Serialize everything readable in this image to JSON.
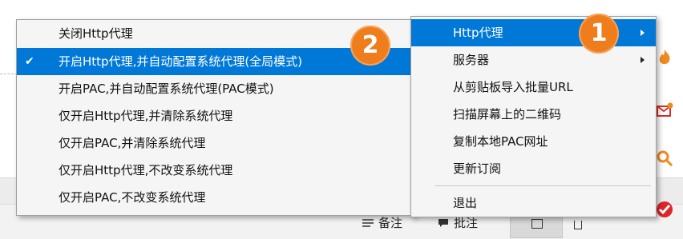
{
  "main_menu": {
    "items": [
      {
        "label": "Http代理",
        "has_submenu": true,
        "highlighted": true
      },
      {
        "label": "服务器",
        "has_submenu": true
      },
      {
        "label": "从剪贴板导入批量URL"
      },
      {
        "label": "扫描屏幕上的二维码"
      },
      {
        "label": "复制本地PAC网址"
      },
      {
        "label": "更新订阅"
      },
      {
        "label": "退出"
      }
    ]
  },
  "http_submenu": {
    "items": [
      {
        "label": "关闭Http代理"
      },
      {
        "label": "开启Http代理,并自动配置系统代理(全局模式)",
        "checked": true,
        "highlighted": true
      },
      {
        "label": "开启PAC,并自动配置系统代理(PAC模式)"
      },
      {
        "label": "仅开启Http代理,并清除系统代理"
      },
      {
        "label": "仅开启PAC,并清除系统代理"
      },
      {
        "label": "仅开启Http代理,不改变系统代理"
      },
      {
        "label": "仅开启PAC,不改变系统代理"
      }
    ]
  },
  "check_mark": "✔",
  "badges": [
    "2",
    "1"
  ],
  "status_bar": {
    "notes_label": "备注",
    "comments_label": "批注"
  },
  "colors": {
    "highlight": "#0078d7",
    "badge": "#f07d1c",
    "menu_bg": "#f5f5f5"
  }
}
